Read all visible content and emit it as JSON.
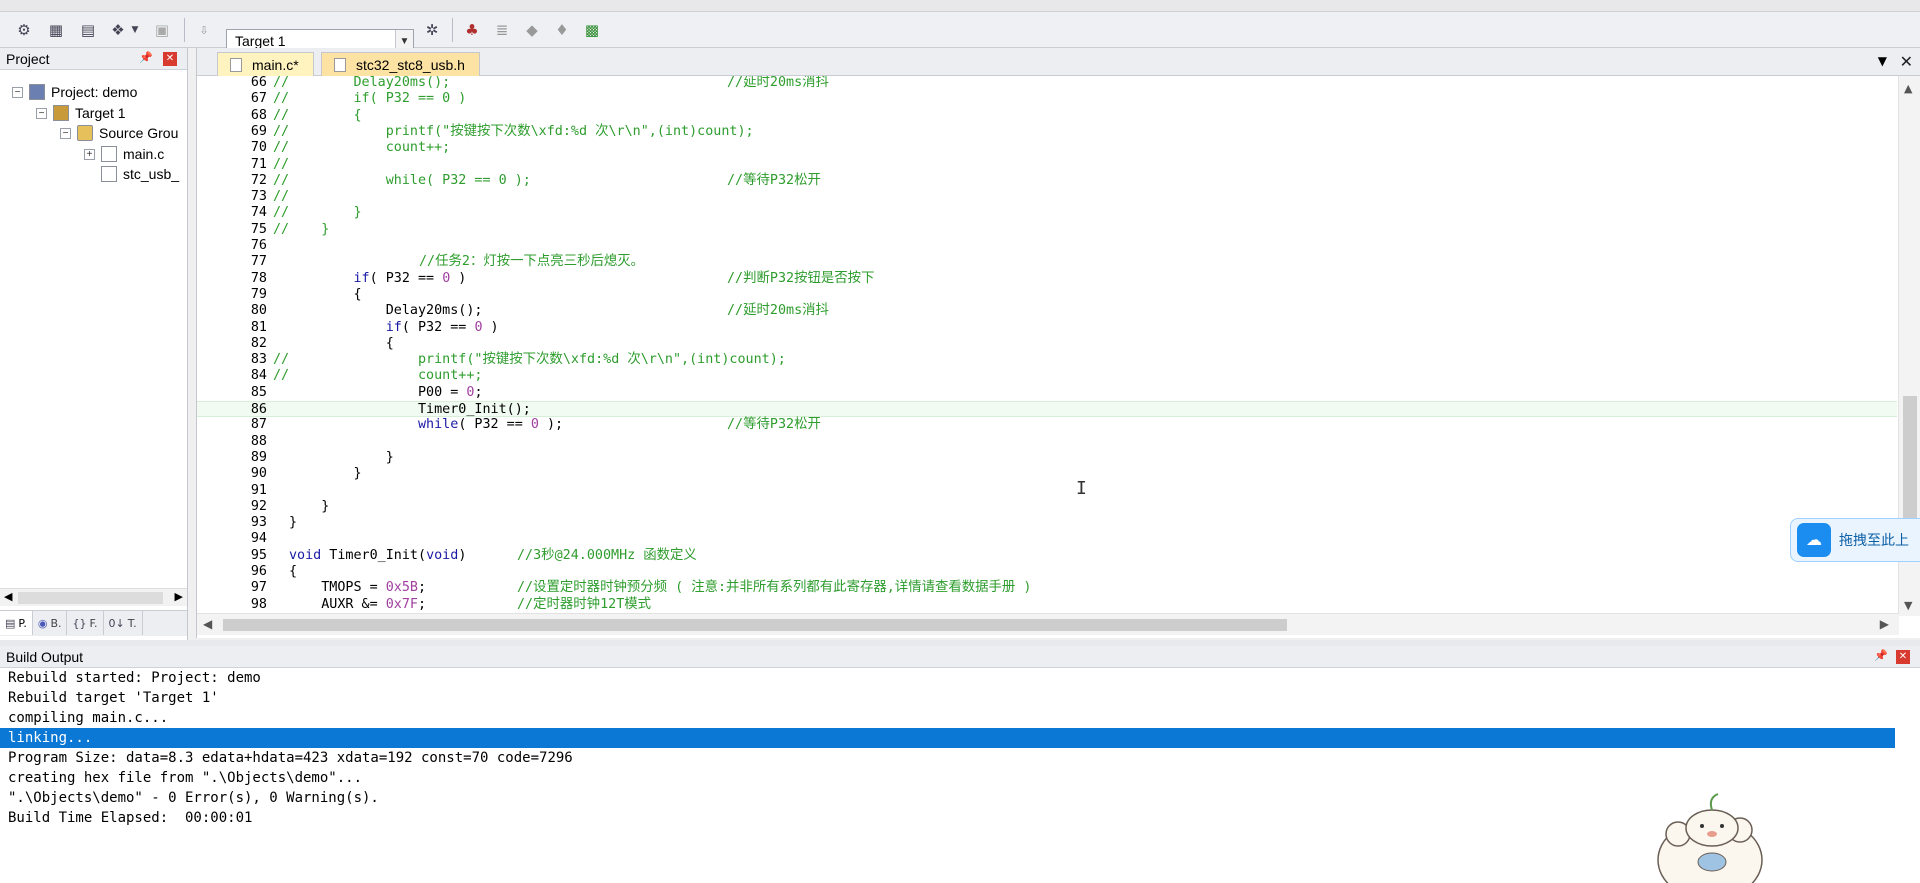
{
  "toolbar": {
    "target_value": "Target 1"
  },
  "project_panel": {
    "title": "Project",
    "tree": [
      {
        "label": "Project: demo",
        "indent": 0,
        "icon": "project-icon",
        "expander": "−"
      },
      {
        "label": "Target 1",
        "indent": 1,
        "icon": "target-icon",
        "expander": "−"
      },
      {
        "label": "Source Grou",
        "indent": 2,
        "icon": "folder-icon",
        "expander": "−"
      },
      {
        "label": "main.c",
        "indent": 3,
        "icon": "file-icon",
        "expander": "+"
      },
      {
        "label": "stc_usb_",
        "indent": 3,
        "icon": "file-icon",
        "expander": ""
      }
    ],
    "tabs": [
      "P.",
      "B.",
      "F.",
      "T."
    ]
  },
  "editor": {
    "tabs": [
      {
        "label": "main.c*",
        "active": true
      },
      {
        "label": "stc32_stc8_usb.h",
        "active": false
      }
    ],
    "current_line": 86,
    "lines": [
      {
        "n": "66",
        "pre": "//",
        "code": "        Delay20ms();",
        "comment": "//延时20ms消抖"
      },
      {
        "n": "67",
        "pre": "//",
        "code": "        if( P32 == 0 )",
        "comment": ""
      },
      {
        "n": "68",
        "pre": "//",
        "code": "        {",
        "comment": ""
      },
      {
        "n": "69",
        "pre": "//",
        "code": "            printf(\"按键按下次数\\xfd:%d 次\\r\\n\",(int)count);",
        "comment": ""
      },
      {
        "n": "70",
        "pre": "//",
        "code": "            count++;",
        "comment": ""
      },
      {
        "n": "71",
        "pre": "//",
        "code": "",
        "comment": ""
      },
      {
        "n": "72",
        "pre": "//",
        "code": "            while( P32 == 0 );",
        "comment": "//等待P32松开"
      },
      {
        "n": "73",
        "pre": "//",
        "code": "",
        "comment": ""
      },
      {
        "n": "74",
        "pre": "//",
        "code": "        }",
        "comment": ""
      },
      {
        "n": "75",
        "pre": "//",
        "code": "    }",
        "comment": ""
      },
      {
        "n": "76",
        "pre": "",
        "code": "",
        "comment": ""
      },
      {
        "n": "77",
        "pre": "",
        "code": "        ",
        "comment": "//任务2：灯按一下点亮三秒后熄灭。"
      },
      {
        "n": "78",
        "pre": "",
        "code": "        if( P32 == 0 )",
        "comment": "//判断P32按钮是否按下"
      },
      {
        "n": "79",
        "pre": "",
        "code": "        {",
        "comment": ""
      },
      {
        "n": "80",
        "pre": "",
        "code": "            Delay20ms();",
        "comment": "//延时20ms消抖"
      },
      {
        "n": "81",
        "pre": "",
        "code": "            if( P32 == 0 )",
        "comment": ""
      },
      {
        "n": "82",
        "pre": "",
        "code": "            {",
        "comment": ""
      },
      {
        "n": "83",
        "pre": "//",
        "code": "                printf(\"按键按下次数\\xfd:%d 次\\r\\n\",(int)count);",
        "comment": ""
      },
      {
        "n": "84",
        "pre": "//",
        "code": "                count++;",
        "comment": ""
      },
      {
        "n": "85",
        "pre": "",
        "code": "                P00 = 0;",
        "comment": ""
      },
      {
        "n": "86",
        "pre": "",
        "code": "                Timer0_Init();",
        "comment": ""
      },
      {
        "n": "87",
        "pre": "",
        "code": "                while( P32 == 0 );",
        "comment": "//等待P32松开"
      },
      {
        "n": "88",
        "pre": "",
        "code": "",
        "comment": ""
      },
      {
        "n": "89",
        "pre": "",
        "code": "            }",
        "comment": ""
      },
      {
        "n": "90",
        "pre": "",
        "code": "        }",
        "comment": ""
      },
      {
        "n": "91",
        "pre": "",
        "code": "",
        "comment": ""
      },
      {
        "n": "92",
        "pre": "",
        "code": "    }",
        "comment": ""
      },
      {
        "n": "93",
        "pre": "",
        "code": "}",
        "comment": ""
      },
      {
        "n": "94",
        "pre": "",
        "code": "",
        "comment": ""
      },
      {
        "n": "95",
        "pre": "",
        "code": "void Timer0_Init(void)",
        "comment": "//3秒@24.000MHz 函数定义"
      },
      {
        "n": "96",
        "pre": "",
        "code": "{",
        "comment": ""
      },
      {
        "n": "97",
        "pre": "",
        "code": "    TMOPS = 0x5B;",
        "comment": "//设置定时器时钟预分频 ( 注意:并非所有系列都有此寄存器,详情请查看数据手册 )"
      },
      {
        "n": "98",
        "pre": "",
        "code": "    AUXR &= 0x7F;",
        "comment": "//定时器时钟12T模式"
      }
    ]
  },
  "build_output": {
    "title": "Build Output",
    "lines": [
      {
        "text": "Rebuild started: Project: demo",
        "selected": false
      },
      {
        "text": "Rebuild target 'Target 1'",
        "selected": false
      },
      {
        "text": "compiling main.c...",
        "selected": false
      },
      {
        "text": "linking...",
        "selected": true
      },
      {
        "text": "Program Size: data=8.3 edata+hdata=423 xdata=192 const=70 code=7296",
        "selected": false
      },
      {
        "text": "creating hex file from \".\\Objects\\demo\"...",
        "selected": false
      },
      {
        "text": "\".\\Objects\\demo\" - 0 Error(s), 0 Warning(s).",
        "selected": false
      },
      {
        "text": "Build Time Elapsed:  00:00:01",
        "selected": false
      }
    ]
  },
  "overlay": {
    "drag_upload_label": "拖拽至此上"
  }
}
